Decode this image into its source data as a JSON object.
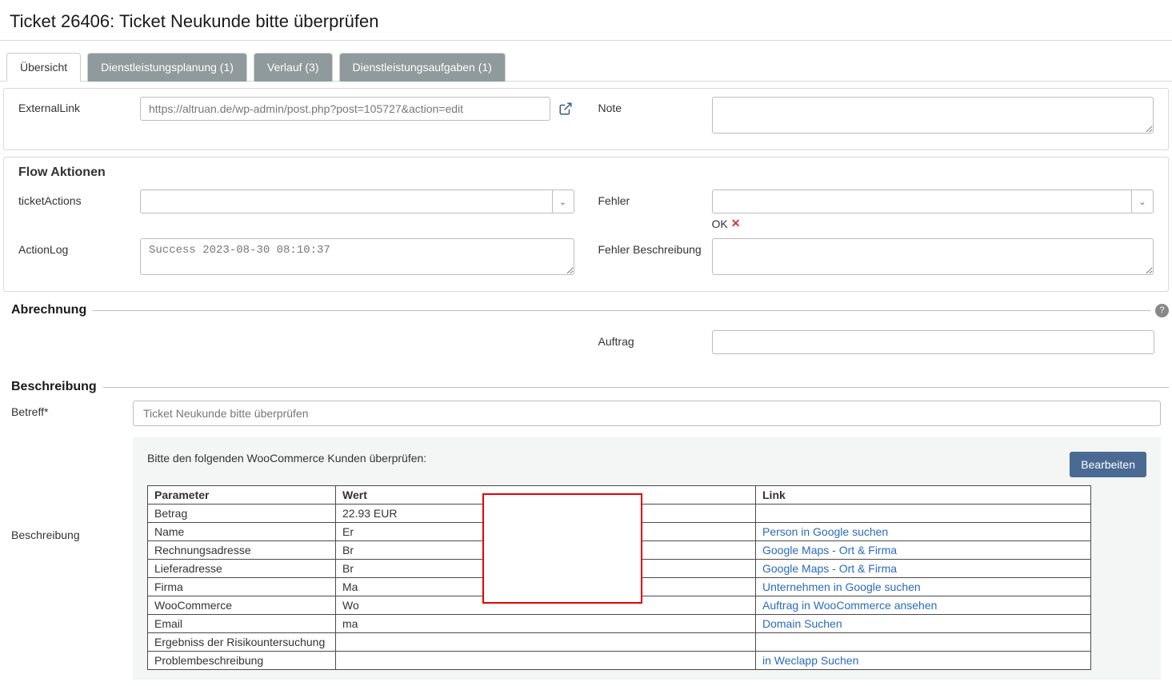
{
  "page": {
    "title": "Ticket 26406: Ticket Neukunde bitte überprüfen"
  },
  "tabs": [
    {
      "label": "Übersicht",
      "active": true
    },
    {
      "label": "Dienstleistungsplanung (1)",
      "active": false
    },
    {
      "label": "Verlauf (3)",
      "active": false
    },
    {
      "label": "Dienstleistungsaufgaben (1)",
      "active": false
    }
  ],
  "externalLink": {
    "label": "ExternalLink",
    "value": "https://altruan.de/wp-admin/post.php?post=105727&action=edit"
  },
  "note": {
    "label": "Note",
    "value": ""
  },
  "flowActions": {
    "heading": "Flow Aktionen",
    "ticketActions": {
      "label": "ticketActions",
      "value": ""
    },
    "fehler": {
      "label": "Fehler",
      "value": "",
      "status": "OK"
    },
    "actionLog": {
      "label": "ActionLog",
      "value": "Success 2023-08-30 08:10:37"
    },
    "fehlerBeschreibung": {
      "label": "Fehler Beschreibung",
      "value": ""
    }
  },
  "abrechnung": {
    "heading": "Abrechnung",
    "auftrag": {
      "label": "Auftrag",
      "value": ""
    }
  },
  "beschreibung": {
    "heading": "Beschreibung",
    "betreff": {
      "label": "Betreff*",
      "value": "Ticket Neukunde bitte überprüfen"
    },
    "descLabel": "Beschreibung",
    "intro": "Bitte den folgenden WooCommerce Kunden überprüfen:",
    "editBtn": "Bearbeiten",
    "table": {
      "headers": {
        "param": "Parameter",
        "wert": "Wert",
        "link": "Link"
      },
      "rows": [
        {
          "param": "Betrag",
          "wert": "22.93 EUR",
          "link": ""
        },
        {
          "param": "Name",
          "wert": "Er",
          "link": "Person in Google suchen"
        },
        {
          "param": "Rechnungsadresse",
          "wert": "Br",
          "link": "Google Maps - Ort & Firma"
        },
        {
          "param": "Lieferadresse",
          "wert": "Br",
          "link": "Google Maps - Ort & Firma"
        },
        {
          "param": "Firma",
          "wert": "Ma",
          "link": "Unternehmen in Google suchen"
        },
        {
          "param": "WooCommerce",
          "wert": "Wo",
          "link": "Auftrag in WooCommerce ansehen"
        },
        {
          "param": "Email",
          "wert": "ma",
          "link": "Domain Suchen"
        },
        {
          "param": "Ergebniss der Risikountersuchung",
          "wert": "",
          "link": ""
        },
        {
          "param": "Problembeschreibung",
          "wert": "",
          "link": "in Weclapp Suchen"
        }
      ]
    }
  }
}
